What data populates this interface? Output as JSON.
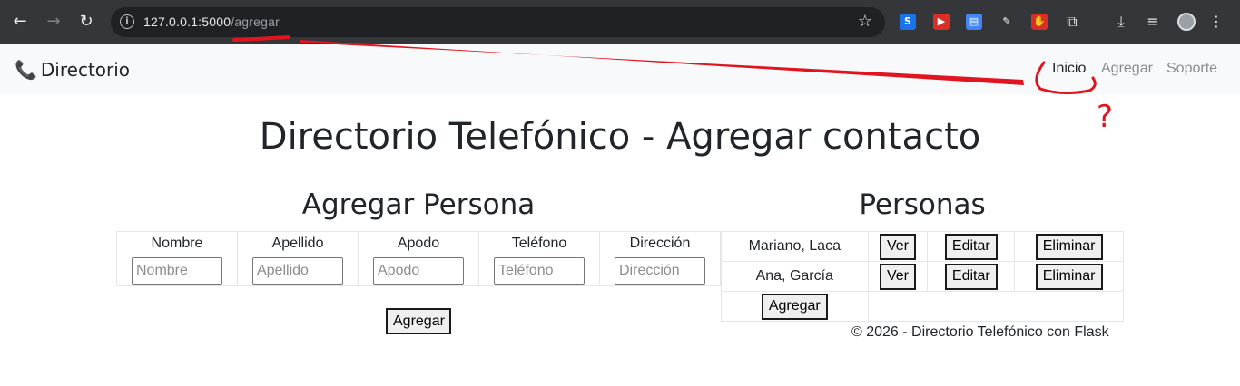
{
  "browser": {
    "url_host": "127.0.0.1:5000",
    "url_path": "/agregar",
    "extensions": [
      {
        "name": "s-ext-icon",
        "glyph": "S",
        "bg": "#1a73e8"
      },
      {
        "name": "media-ext-icon",
        "glyph": "▶",
        "bg": "#d93025"
      },
      {
        "name": "docs-ext-icon",
        "glyph": "▤",
        "bg": "#4285f4"
      },
      {
        "name": "pen-ext-icon",
        "glyph": "✎",
        "bg": "#35363a"
      },
      {
        "name": "stop-ext-icon",
        "glyph": "✋",
        "bg": "#d93025"
      }
    ]
  },
  "navbar": {
    "brand": "Directorio",
    "links": [
      "Inicio",
      "Agregar",
      "Soporte"
    ]
  },
  "page": {
    "title": "Directorio Telefónico - Agregar contacto"
  },
  "form": {
    "heading": "Agregar Persona",
    "columns": [
      "Nombre",
      "Apellido",
      "Apodo",
      "Teléfono",
      "Dirección"
    ],
    "placeholders": [
      "Nombre",
      "Apellido",
      "Apodo",
      "Teléfono",
      "Dirección"
    ],
    "submit_label": "Agregar"
  },
  "personas": {
    "heading": "Personas",
    "rows": [
      {
        "name": "Mariano, Laca",
        "ver": "Ver",
        "editar": "Editar",
        "eliminar": "Eliminar"
      },
      {
        "name": "Ana, García",
        "ver": "Ver",
        "editar": "Editar",
        "eliminar": "Eliminar"
      }
    ],
    "add_label": "Agregar"
  },
  "footer": {
    "text": "© 2026 - Directorio Telefónico con Flask"
  },
  "annotation": {
    "question_mark": "?",
    "color": "#e0151f"
  }
}
